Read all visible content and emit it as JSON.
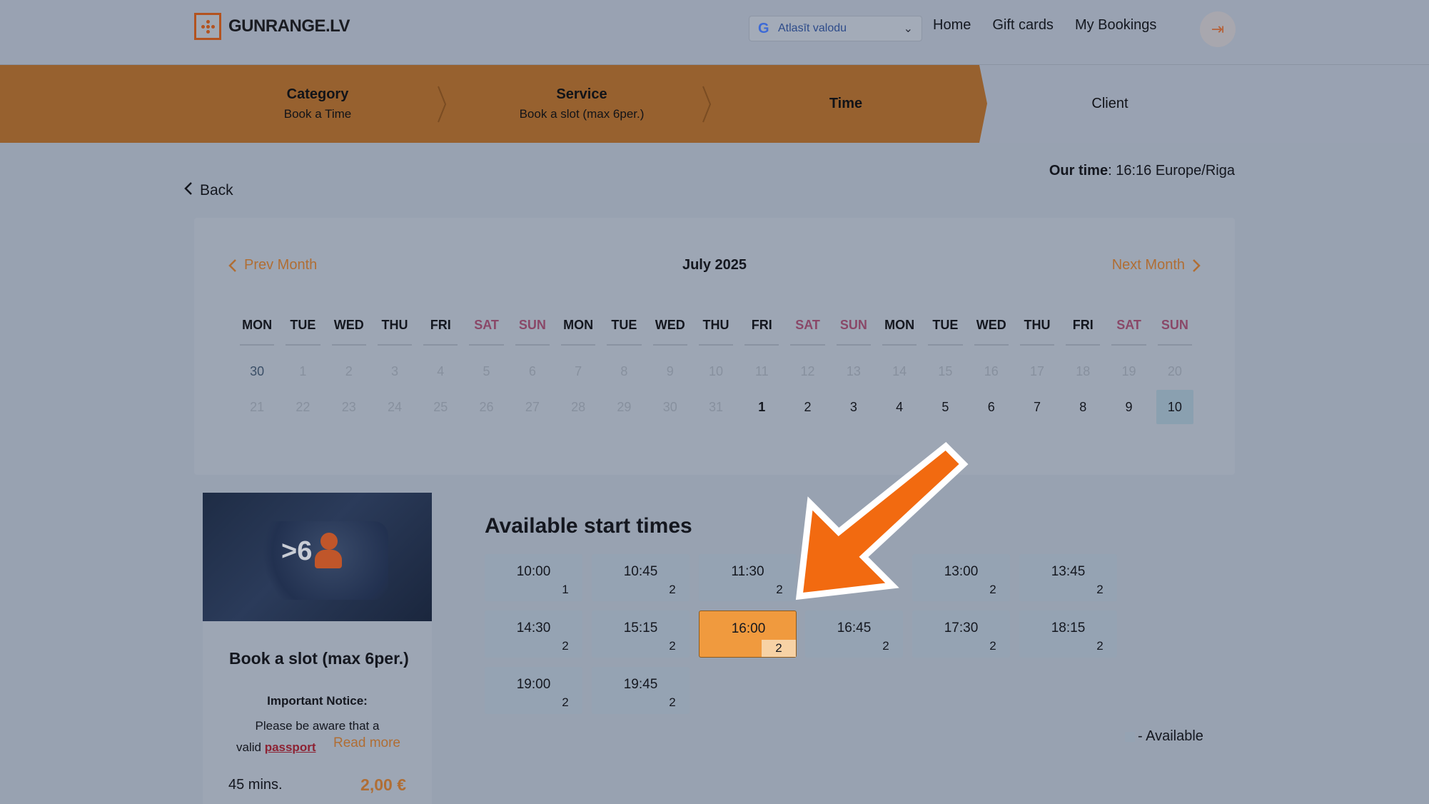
{
  "header": {
    "logo_text": "GUNRANGE.LV",
    "language_select": "Atlasīt valodu",
    "nav": [
      "Home",
      "Gift cards",
      "My Bookings"
    ]
  },
  "steps": [
    {
      "title": "Category",
      "sub": "Book a Time"
    },
    {
      "title": "Service",
      "sub": "Book a slot (max 6per.)"
    },
    {
      "title": "Time",
      "sub": ""
    },
    {
      "title": "Client",
      "sub": ""
    }
  ],
  "our_time": {
    "label": "Our time",
    "value": ": 16:16 Europe/Riga"
  },
  "back_label": "Back",
  "calendar": {
    "prev": "Prev Month",
    "next": "Next Month",
    "title": "July 2025",
    "weekdays": [
      "MON",
      "TUE",
      "WED",
      "THU",
      "FRI",
      "SAT",
      "SUN",
      "MON",
      "TUE",
      "WED",
      "THU",
      "FRI",
      "SAT",
      "SUN",
      "MON",
      "TUE",
      "WED",
      "THU",
      "FRI",
      "SAT",
      "SUN"
    ],
    "row1": [
      "30",
      "1",
      "2",
      "3",
      "4",
      "5",
      "6",
      "7",
      "8",
      "9",
      "10",
      "11",
      "12",
      "13",
      "14",
      "15",
      "16",
      "17",
      "18",
      "19",
      "20"
    ],
    "row2": [
      "21",
      "22",
      "23",
      "24",
      "25",
      "26",
      "27",
      "28",
      "29",
      "30",
      "31",
      "1",
      "2",
      "3",
      "4",
      "5",
      "6",
      "7",
      "8",
      "9",
      "10"
    ]
  },
  "service": {
    "badge": ">6",
    "title": "Book a slot (max 6per.)",
    "notice_heading": "Important Notice:",
    "notice_line1": "Please be aware that a",
    "notice_line2_prefix": "valid ",
    "notice_link": "passport",
    "read_more": "Read more",
    "duration": "45 mins.",
    "price": "2,00 €"
  },
  "times": {
    "heading": "Available start times",
    "slots": [
      {
        "time": "10:00",
        "count": "1"
      },
      {
        "time": "10:45",
        "count": "2"
      },
      {
        "time": "11:30",
        "count": "2"
      },
      {
        "time": "13:00",
        "count": "2"
      },
      {
        "time": "13:45",
        "count": "2"
      },
      {
        "time": "14:30",
        "count": "2"
      },
      {
        "time": "15:15",
        "count": "2"
      },
      {
        "time": "16:00",
        "count": "2",
        "selected": true
      },
      {
        "time": "16:45",
        "count": "2"
      },
      {
        "time": "17:30",
        "count": "2"
      },
      {
        "time": "18:15",
        "count": "2"
      },
      {
        "time": "19:00",
        "count": "2"
      },
      {
        "time": "19:45",
        "count": "2"
      }
    ],
    "legend": "- Available"
  },
  "colors": {
    "accent": "#b06e34",
    "selected_slot": "#f09a3e",
    "arrow": "#f26a10"
  }
}
